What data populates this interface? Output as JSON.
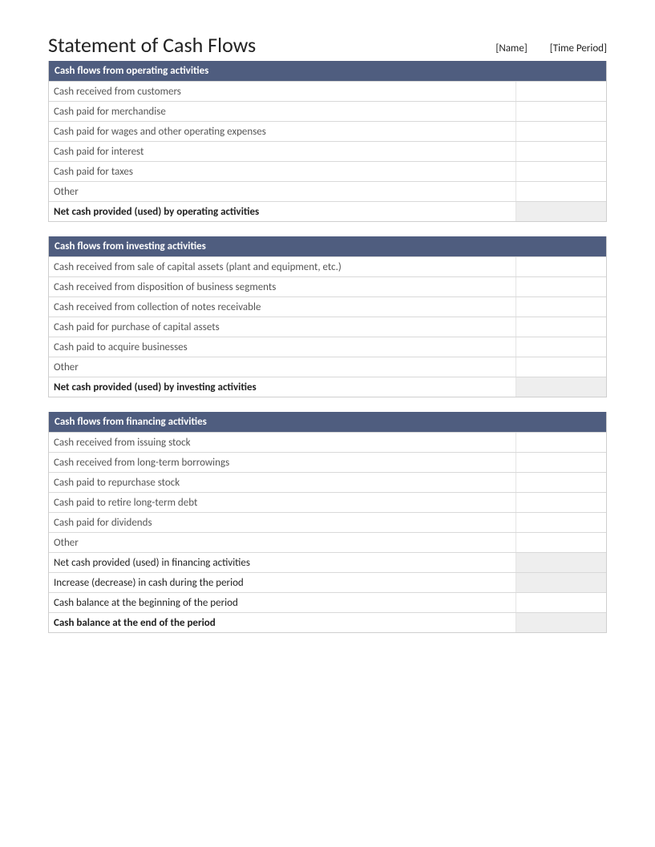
{
  "title": "Statement of Cash Flows",
  "meta": {
    "name": "[Name]",
    "period": "[Time Period]"
  },
  "sections": [
    {
      "header": "Cash flows from operating activities",
      "rows": [
        {
          "label": "Cash received from customers",
          "value": "",
          "style": "normal"
        },
        {
          "label": "Cash paid for merchandise",
          "value": "",
          "style": "normal"
        },
        {
          "label": "Cash paid for wages and other operating expenses",
          "value": "",
          "style": "normal"
        },
        {
          "label": "Cash paid for interest",
          "value": "",
          "style": "normal"
        },
        {
          "label": "Cash paid for taxes",
          "value": "",
          "style": "normal"
        },
        {
          "label": "Other",
          "value": "",
          "style": "normal"
        },
        {
          "label": "Net cash provided (used) by operating activities",
          "value": "",
          "style": "total"
        }
      ]
    },
    {
      "header": "Cash flows from investing activities",
      "rows": [
        {
          "label": "Cash received from sale of capital assets (plant and equipment, etc.)",
          "value": "",
          "style": "normal"
        },
        {
          "label": "Cash received from disposition of business segments",
          "value": "",
          "style": "normal"
        },
        {
          "label": "Cash received from collection of notes receivable",
          "value": "",
          "style": "normal"
        },
        {
          "label": "Cash paid for purchase of capital assets",
          "value": "",
          "style": "normal"
        },
        {
          "label": "Cash paid to acquire businesses",
          "value": "",
          "style": "normal"
        },
        {
          "label": "Other",
          "value": "",
          "style": "normal"
        },
        {
          "label": "Net cash provided (used) by investing activities",
          "value": "",
          "style": "total"
        }
      ]
    },
    {
      "header": "Cash flows from financing activities",
      "rows": [
        {
          "label": "Cash received from issuing stock",
          "value": "",
          "style": "normal"
        },
        {
          "label": "Cash received from long-term borrowings",
          "value": "",
          "style": "normal"
        },
        {
          "label": "Cash paid to repurchase stock",
          "value": "",
          "style": "normal"
        },
        {
          "label": "Cash paid to retire long-term debt",
          "value": "",
          "style": "normal"
        },
        {
          "label": "Cash paid for dividends",
          "value": "",
          "style": "normal"
        },
        {
          "label": "Other",
          "value": "",
          "style": "normal"
        },
        {
          "label": "Net cash provided (used) in financing activities",
          "value": "",
          "style": "subtotal"
        },
        {
          "label": "Increase (decrease) in cash during the period",
          "value": "",
          "style": "subtotal"
        },
        {
          "label": "Cash balance at the beginning of the period",
          "value": "",
          "style": "plain-dark"
        },
        {
          "label": "Cash balance at the end of the period",
          "value": "",
          "style": "total"
        }
      ]
    }
  ]
}
